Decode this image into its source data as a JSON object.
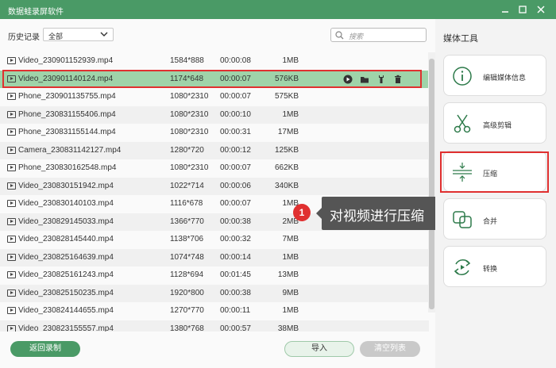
{
  "app": {
    "title": "数据蛙录屏软件"
  },
  "toolbar": {
    "history_label": "历史记录",
    "filter_value": "全部",
    "search_placeholder": "搜索"
  },
  "files": [
    {
      "name": "Video_230901152939.mp4",
      "resolution": "1584*888",
      "duration": "00:00:08",
      "size": "1MB"
    },
    {
      "name": "Video_230901140124.mp4",
      "resolution": "1174*648",
      "duration": "00:00:07",
      "size": "576KB",
      "selected": true
    },
    {
      "name": "Phone_230901135755.mp4",
      "resolution": "1080*2310",
      "duration": "00:00:07",
      "size": "575KB"
    },
    {
      "name": "Phone_230831155406.mp4",
      "resolution": "1080*2310",
      "duration": "00:00:10",
      "size": "1MB"
    },
    {
      "name": "Phone_230831155144.mp4",
      "resolution": "1080*2310",
      "duration": "00:00:31",
      "size": "17MB"
    },
    {
      "name": "Camera_230831142127.mp4",
      "resolution": "1280*720",
      "duration": "00:00:12",
      "size": "125KB"
    },
    {
      "name": "Phone_230830162548.mp4",
      "resolution": "1080*2310",
      "duration": "00:00:07",
      "size": "662KB"
    },
    {
      "name": "Video_230830151942.mp4",
      "resolution": "1022*714",
      "duration": "00:00:06",
      "size": "340KB"
    },
    {
      "name": "Video_230830140103.mp4",
      "resolution": "1116*678",
      "duration": "00:00:07",
      "size": "1MB"
    },
    {
      "name": "Video_230829145033.mp4",
      "resolution": "1366*770",
      "duration": "00:00:38",
      "size": "2MB"
    },
    {
      "name": "Video_230828145440.mp4",
      "resolution": "1138*706",
      "duration": "00:00:32",
      "size": "7MB"
    },
    {
      "name": "Video_230825164639.mp4",
      "resolution": "1074*748",
      "duration": "00:00:14",
      "size": "1MB"
    },
    {
      "name": "Video_230825161243.mp4",
      "resolution": "1128*694",
      "duration": "00:01:45",
      "size": "13MB"
    },
    {
      "name": "Video_230825150235.mp4",
      "resolution": "1920*800",
      "duration": "00:00:38",
      "size": "9MB"
    },
    {
      "name": "Video_230824144655.mp4",
      "resolution": "1270*770",
      "duration": "00:00:11",
      "size": "1MB"
    },
    {
      "name": "Video_230823155557.mp4",
      "resolution": "1380*768",
      "duration": "00:00:57",
      "size": "38MB"
    }
  ],
  "row_action_icons": [
    "play-icon",
    "folder-icon",
    "wrench-icon",
    "trash-icon"
  ],
  "callout": {
    "number": "1",
    "text": "对视频进行压缩"
  },
  "footer": {
    "back_label": "返回录制",
    "import_label": "导入",
    "clear_label": "清空列表"
  },
  "media_tools": {
    "title": "媒体工具",
    "items": [
      {
        "label": "编辑媒体信息",
        "icon": "info-icon"
      },
      {
        "label": "高级剪辑",
        "icon": "scissors-icon"
      },
      {
        "label": "压缩",
        "icon": "compress-icon",
        "highlighted": true
      },
      {
        "label": "合并",
        "icon": "merge-icon"
      },
      {
        "label": "转换",
        "icon": "convert-icon"
      }
    ]
  },
  "colors": {
    "brand": "#4a9a66",
    "selected_row": "#9fd3a9",
    "highlight": "#e03030"
  }
}
